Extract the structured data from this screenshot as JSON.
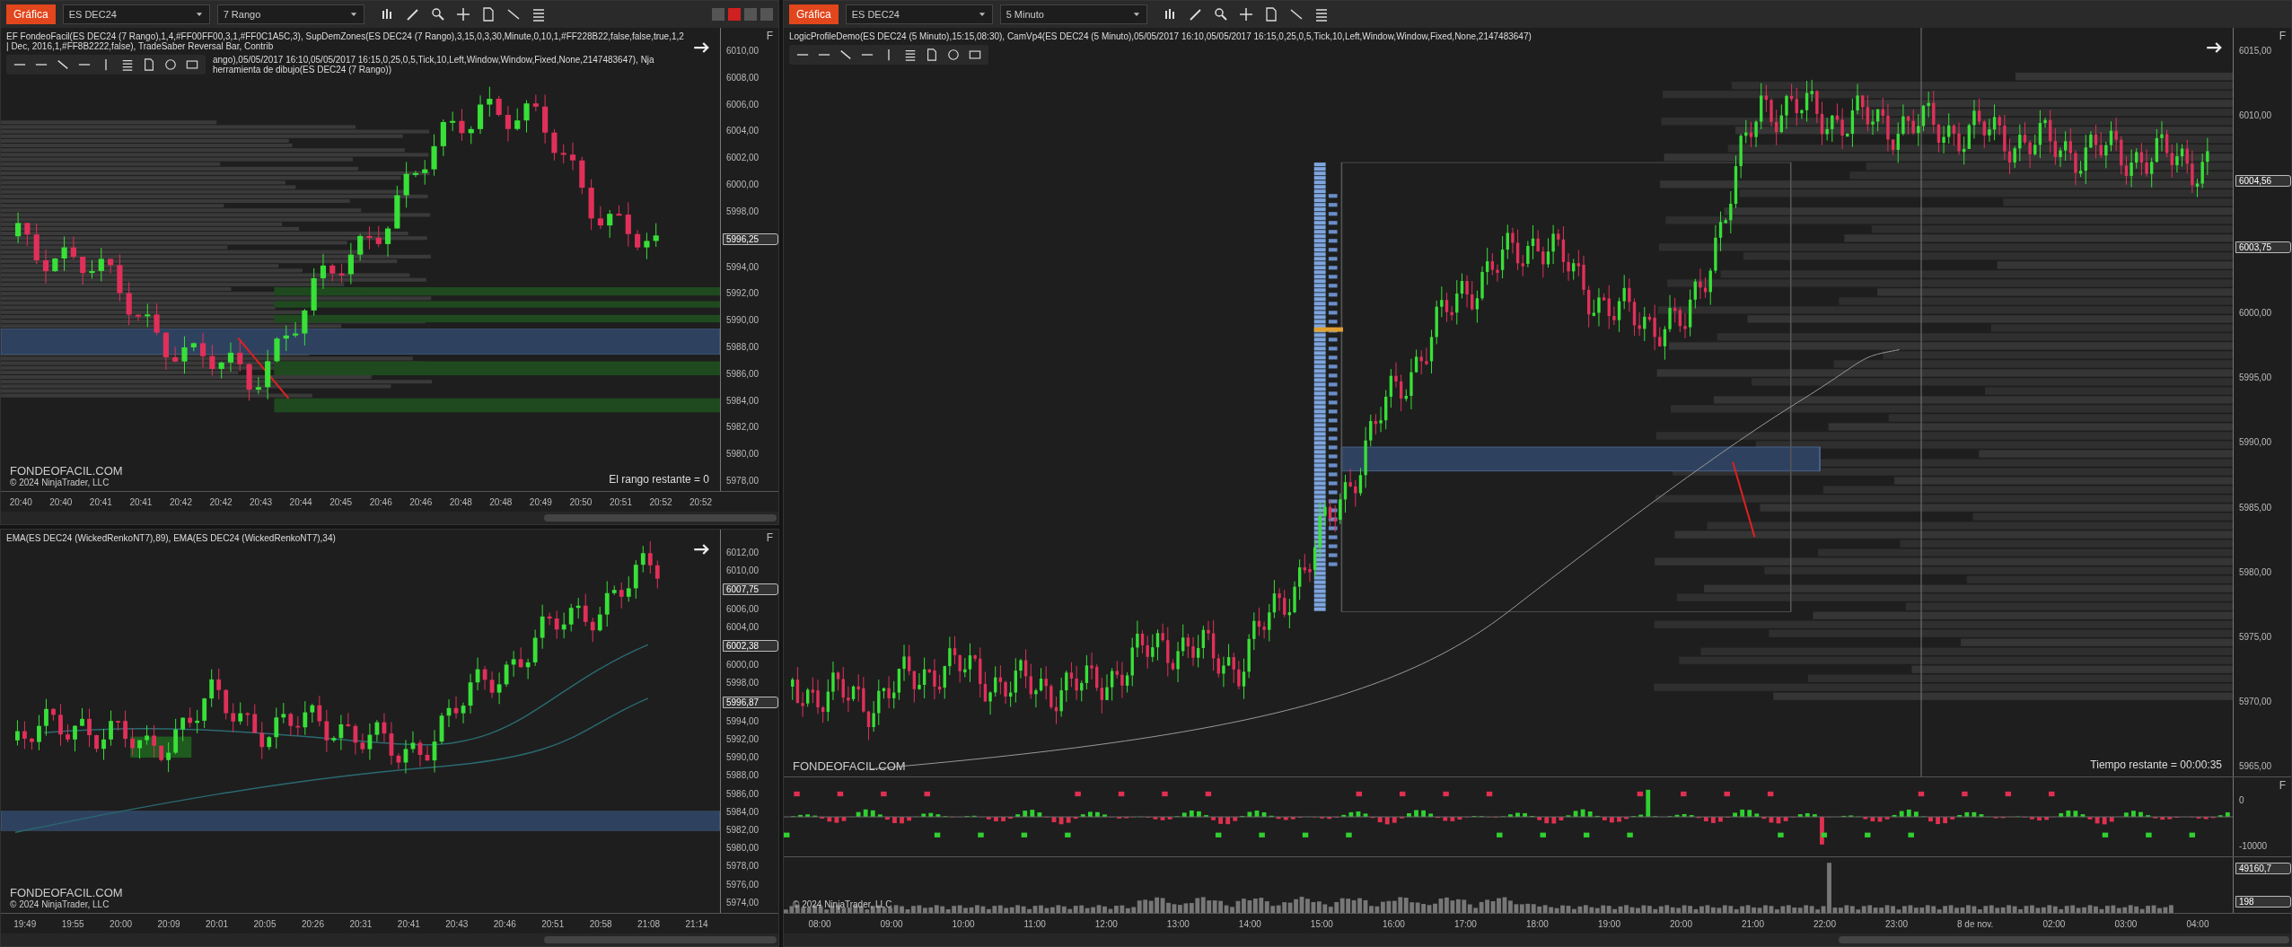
{
  "windows": [
    {
      "toolbar": {
        "menu": "Gráfica",
        "instrument": "ES DEC24",
        "period": "7 Rango",
        "window_buttons": true
      },
      "panes": [
        {
          "kind": "price",
          "indicators": [
            "EF FondeoFacil(ES DEC24 (7 Rango),1,4,#FF00FF00,3,1,#FF0C1A5C,3), SupDemZones(ES DEC24 (7 Rango),3,15,0,3,30,Minute,0,10,1,#FF228B22,false,false,true,1,2 | Dec, 2016,1,#FF8B2222,false), TradeSaber Reversal Bar, Contrib",
            "ango),05/05/2017 16:10,05/05/2017 16:15,0,25,0,5,Tick,10,Left,Window,Window,Fixed,None,2147483647), Nja herramienta de dibujo(ES DEC24 (7 Rango))"
          ],
          "panel_label": "F",
          "watermark": "FONDEOFACIL.COM",
          "copyright": "© 2024 NinjaTrader, LLC",
          "status": "El rango restante = 0",
          "price_axis": [
            {
              "text": "6010,00",
              "kind": "tick"
            },
            {
              "text": "6008,00",
              "kind": "tick"
            },
            {
              "text": "6006,00",
              "kind": "tick"
            },
            {
              "text": "6004,00",
              "kind": "tick"
            },
            {
              "text": "6002,00",
              "kind": "tick"
            },
            {
              "text": "6000,00",
              "kind": "tick"
            },
            {
              "text": "5998,00",
              "kind": "tick"
            },
            {
              "text": "5996,25",
              "kind": "marker"
            },
            {
              "text": "5994,00",
              "kind": "tick"
            },
            {
              "text": "5992,00",
              "kind": "tick"
            },
            {
              "text": "5990,00",
              "kind": "tick"
            },
            {
              "text": "5988,00",
              "kind": "tick"
            },
            {
              "text": "5986,00",
              "kind": "tick"
            },
            {
              "text": "5984,00",
              "kind": "tick"
            },
            {
              "text": "5982,00",
              "kind": "tick"
            },
            {
              "text": "5980,00",
              "kind": "tick"
            },
            {
              "text": "5978,00",
              "kind": "tick"
            }
          ]
        }
      ],
      "time_axis": [
        "20:40",
        "20:40",
        "20:41",
        "20:41",
        "20:42",
        "20:42",
        "20:43",
        "20:44",
        "20:45",
        "20:46",
        "20:46",
        "20:48",
        "20:48",
        "20:49",
        "20:50",
        "20:51",
        "20:52",
        "20:52"
      ]
    },
    {
      "panes": [
        {
          "kind": "price",
          "indicators": [
            "EMA(ES DEC24 (WickedRenkoNT7),89), EMA(ES DEC24 (WickedRenkoNT7),34)"
          ],
          "panel_label": "F",
          "watermark": "FONDEOFACIL.COM",
          "copyright": "© 2024 NinjaTrader, LLC",
          "price_axis": [
            {
              "text": "6012,00",
              "kind": "tick"
            },
            {
              "text": "6010,00",
              "kind": "tick"
            },
            {
              "text": "6007,75",
              "kind": "marker"
            },
            {
              "text": "6006,00",
              "kind": "tick"
            },
            {
              "text": "6004,00",
              "kind": "tick"
            },
            {
              "text": "6002,38",
              "kind": "marker"
            },
            {
              "text": "6000,00",
              "kind": "tick"
            },
            {
              "text": "5998,00",
              "kind": "tick"
            },
            {
              "text": "5996,87",
              "kind": "marker"
            },
            {
              "text": "5994,00",
              "kind": "tick"
            },
            {
              "text": "5992,00",
              "kind": "tick"
            },
            {
              "text": "5990,00",
              "kind": "tick"
            },
            {
              "text": "5988,00",
              "kind": "tick"
            },
            {
              "text": "5986,00",
              "kind": "tick"
            },
            {
              "text": "5984,00",
              "kind": "tick"
            },
            {
              "text": "5982,00",
              "kind": "tick"
            },
            {
              "text": "5980,00",
              "kind": "tick"
            },
            {
              "text": "5978,00",
              "kind": "tick"
            },
            {
              "text": "5976,00",
              "kind": "tick"
            },
            {
              "text": "5974,00",
              "kind": "tick"
            }
          ]
        }
      ],
      "time_axis": [
        "19:49",
        "19:55",
        "20:00",
        "20:09",
        "20:01",
        "20:05",
        "20:26",
        "20:31",
        "20:41",
        "20:43",
        "20:46",
        "20:51",
        "20:58",
        "21:08",
        "21:14"
      ]
    },
    {
      "toolbar": {
        "menu": "Gráfica",
        "instrument": "ES DEC24",
        "period": "5 Minuto",
        "window_buttons": false
      },
      "panes": [
        {
          "kind": "price",
          "indicators": [
            "LogicProfileDemo(ES DEC24 (5 Minuto),15:15,08:30), CamVp4(ES DEC24 (5 Minuto),05/05/2017 16:10,05/05/2017 16:15,0,25,0,5,Tick,10,Left,Window,Window,Fixed,None,2147483647)"
          ],
          "panel_label": "F",
          "watermark": "FONDEOFACIL.COM",
          "status": "Tiempo restante = 00:00:35",
          "price_axis": [
            {
              "text": "6015,00",
              "kind": "tick"
            },
            {
              "text": "6010,00",
              "kind": "tick"
            },
            {
              "text": "6004,56",
              "kind": "marker"
            },
            {
              "text": "6003,75",
              "kind": "marker"
            },
            {
              "text": "6000,00",
              "kind": "tick"
            },
            {
              "text": "5995,00",
              "kind": "tick"
            },
            {
              "text": "5990,00",
              "kind": "tick"
            },
            {
              "text": "5985,00",
              "kind": "tick"
            },
            {
              "text": "5980,00",
              "kind": "tick"
            },
            {
              "text": "5975,00",
              "kind": "tick"
            },
            {
              "text": "5970,00",
              "kind": "tick"
            },
            {
              "text": "5965,00",
              "kind": "tick"
            }
          ]
        },
        {
          "kind": "delta",
          "panel_label": "F",
          "price_axis": [
            {
              "text": "0",
              "kind": "tick"
            },
            {
              "text": "-10000",
              "kind": "tick"
            }
          ]
        },
        {
          "kind": "volume",
          "copyright": "© 2024 NinjaTrader, LLC",
          "price_axis": [
            {
              "text": "49160,7",
              "kind": "marker"
            },
            {
              "text": "198",
              "kind": "marker"
            }
          ]
        }
      ],
      "time_axis": [
        "08:00",
        "09:00",
        "10:00",
        "11:00",
        "12:00",
        "13:00",
        "14:00",
        "15:00",
        "16:00",
        "17:00",
        "18:00",
        "19:00",
        "20:00",
        "21:00",
        "22:00",
        "23:00",
        "8 de nov.",
        "02:00",
        "03:00",
        "04:00"
      ]
    }
  ]
}
